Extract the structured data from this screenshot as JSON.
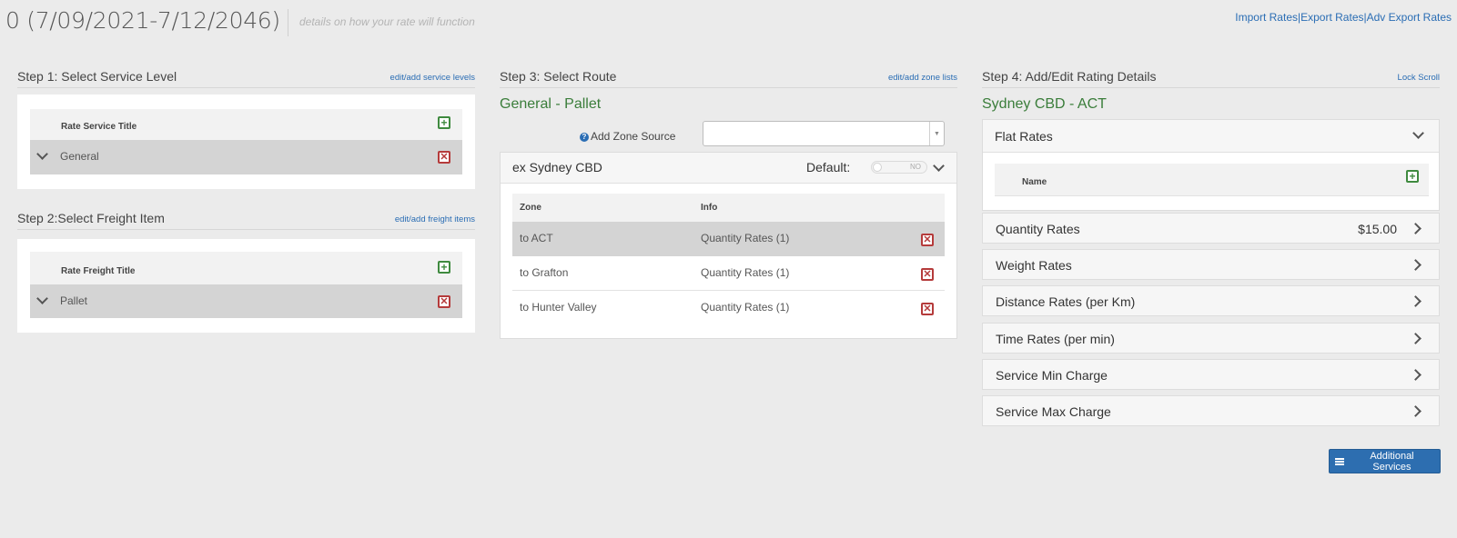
{
  "header": {
    "title": "0 (7/09/2021-7/12/2046)",
    "subtitle": "details on how your rate will function",
    "links": [
      "Import Rates",
      "Export Rates",
      "Adv Export Rates"
    ],
    "link_separator": "|"
  },
  "step1": {
    "title": "Step 1: Select Service Level",
    "link": "edit/add service levels",
    "column_header": "Rate Service Title",
    "rows": [
      "General"
    ]
  },
  "step2": {
    "title": "Step 2:Select Freight Item",
    "link": "edit/add freight items",
    "column_header": "Rate Freight Title",
    "rows": [
      "Pallet"
    ]
  },
  "step3": {
    "title": "Step 3: Select Route",
    "link": "edit/add zone lists",
    "route_name": "General - Pallet",
    "add_zone_source_label": "Add Zone Source",
    "add_zone_source_value": "",
    "panel": {
      "title": "ex Sydney CBD",
      "default_label": "Default:",
      "toggle_text": "NO",
      "columns": [
        "Zone",
        "Info"
      ],
      "rows": [
        {
          "zone": "to ACT",
          "info": "Quantity Rates (1)"
        },
        {
          "zone": "to Grafton",
          "info": "Quantity Rates (1)"
        },
        {
          "zone": "to Hunter Valley",
          "info": "Quantity Rates (1)"
        }
      ]
    }
  },
  "step4": {
    "title": "Step 4: Add/Edit Rating Details",
    "link": "Lock Scroll",
    "route_name": "Sydney CBD - ACT",
    "flat_rates": {
      "title": "Flat Rates",
      "column_header": "Name"
    },
    "sections": [
      {
        "title": "Quantity Rates",
        "value": "$15.00"
      },
      {
        "title": "Weight Rates",
        "value": ""
      },
      {
        "title": "Distance Rates (per Km)",
        "value": ""
      },
      {
        "title": "Time Rates (per min)",
        "value": ""
      },
      {
        "title": "Service Min Charge",
        "value": ""
      },
      {
        "title": "Service Max Charge",
        "value": ""
      }
    ],
    "additional_services_label": "Additional Services"
  },
  "colors": {
    "accent": "#2d6eb0",
    "route_green": "#3a7d3a",
    "add_green": "#3f8a3f",
    "delete_red": "#b53b3b",
    "background": "#ebebeb"
  }
}
